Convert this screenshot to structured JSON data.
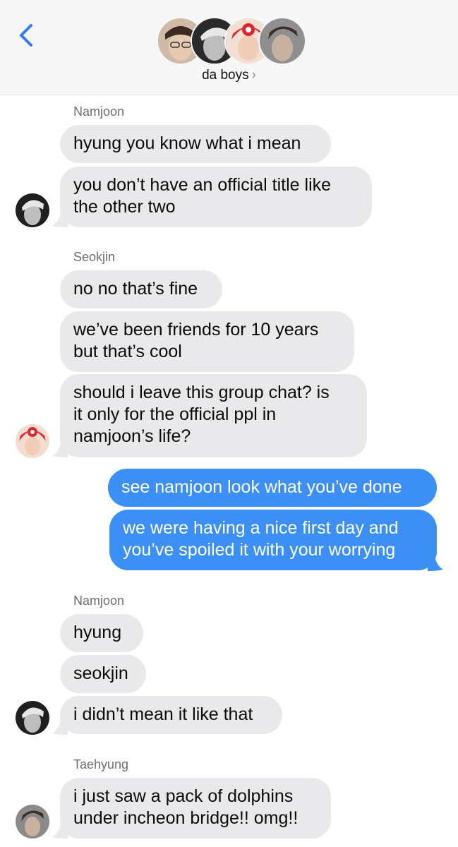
{
  "header": {
    "group_name": "da boys",
    "chevron": "›",
    "back_icon": "chevron-left-icon",
    "accent": "#2f7cf6"
  },
  "messages": [
    {
      "sender": "Namjoon"
    },
    {
      "text": "hyung you know what i mean"
    },
    {
      "text_lines": [
        "you don’t have an official title like",
        "the other two"
      ]
    },
    {
      "sender": "Seokjin"
    },
    {
      "text": "no no that’s fine"
    },
    {
      "text_lines": [
        "we’ve been friends for 10 years",
        "but that’s cool"
      ]
    },
    {
      "text_lines": [
        "should i leave this group chat? is",
        "it only for the official ppl in",
        "namjoon’s life?"
      ]
    },
    {
      "text": "see namjoon look what you’ve done"
    },
    {
      "text_lines": [
        "we were having a nice first day and",
        "you’ve spoiled it with your worrying"
      ]
    },
    {
      "sender": "Namjoon"
    },
    {
      "text": "hyung"
    },
    {
      "text": "seokjin"
    },
    {
      "text": "i didn’t mean it like that"
    },
    {
      "sender": "Taehyung"
    },
    {
      "text_lines": [
        "i just saw a pack of dolphins",
        "under incheon bridge!! omg!!"
      ]
    }
  ],
  "colors": {
    "incoming_bubble": "#e9e9eb",
    "outgoing_bubble": "#3c8ff5"
  }
}
